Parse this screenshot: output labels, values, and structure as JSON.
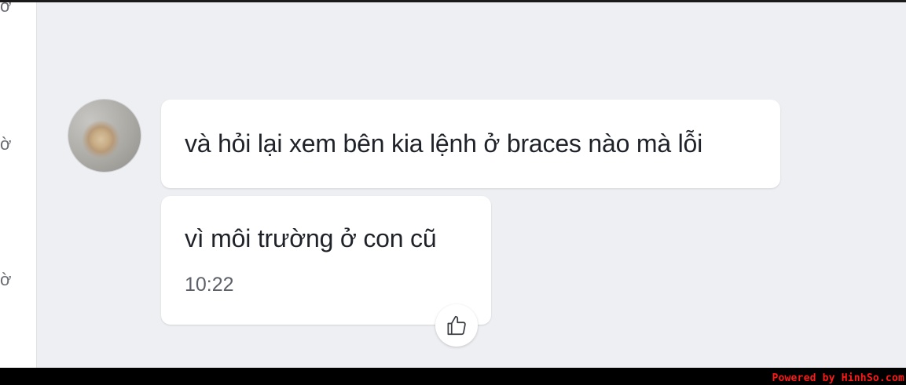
{
  "left_panel": {
    "glyphs": [
      "ờ",
      "ờ",
      "ờ"
    ]
  },
  "chat": {
    "messages": [
      {
        "text": "và hỏi lại xem bên kia lệnh ở braces nào mà lỗi"
      },
      {
        "text": "vì môi trường ở con cũ",
        "time": "10:22"
      }
    ],
    "reaction_icon": "thumbs-up-icon"
  },
  "footer": {
    "watermark": "Powered by HinhSo.com"
  },
  "colors": {
    "chat_background": "#eeeff2",
    "bubble": "#ffffff",
    "text": "#1f2329",
    "watermark": "#ff1a1a"
  }
}
